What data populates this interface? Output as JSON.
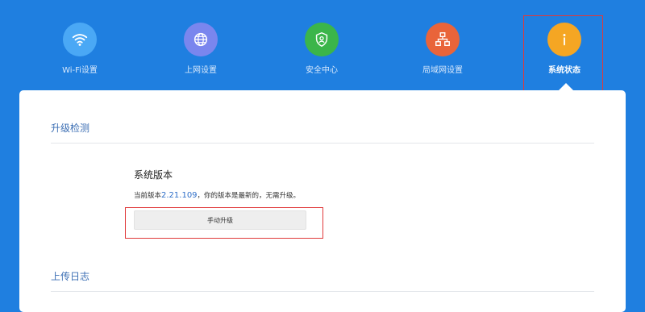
{
  "nav": {
    "items": [
      {
        "label": "Wi-Fi设置",
        "icon": "wifi-icon",
        "color": "#4aa8f5"
      },
      {
        "label": "上网设置",
        "icon": "globe-icon",
        "color": "#7a86ee"
      },
      {
        "label": "安全中心",
        "icon": "shield-user-icon",
        "color": "#3bb54a"
      },
      {
        "label": "局域网设置",
        "icon": "network-icon",
        "color": "#e9643a"
      },
      {
        "label": "系统状态",
        "icon": "info-icon",
        "color": "#f5a623",
        "active": true
      }
    ]
  },
  "upgrade": {
    "section_title": "升级检测",
    "system_version_title": "系统版本",
    "desc_prefix": "当前版本",
    "version": "2.21.109",
    "desc_suffix": "，你的版本是最新的，无需升级。",
    "button_label": "手动升级"
  },
  "log": {
    "section_title": "上传日志"
  },
  "colors": {
    "background": "#1f7fe0",
    "highlight": "#e0393a",
    "link": "#2f6fc8"
  }
}
